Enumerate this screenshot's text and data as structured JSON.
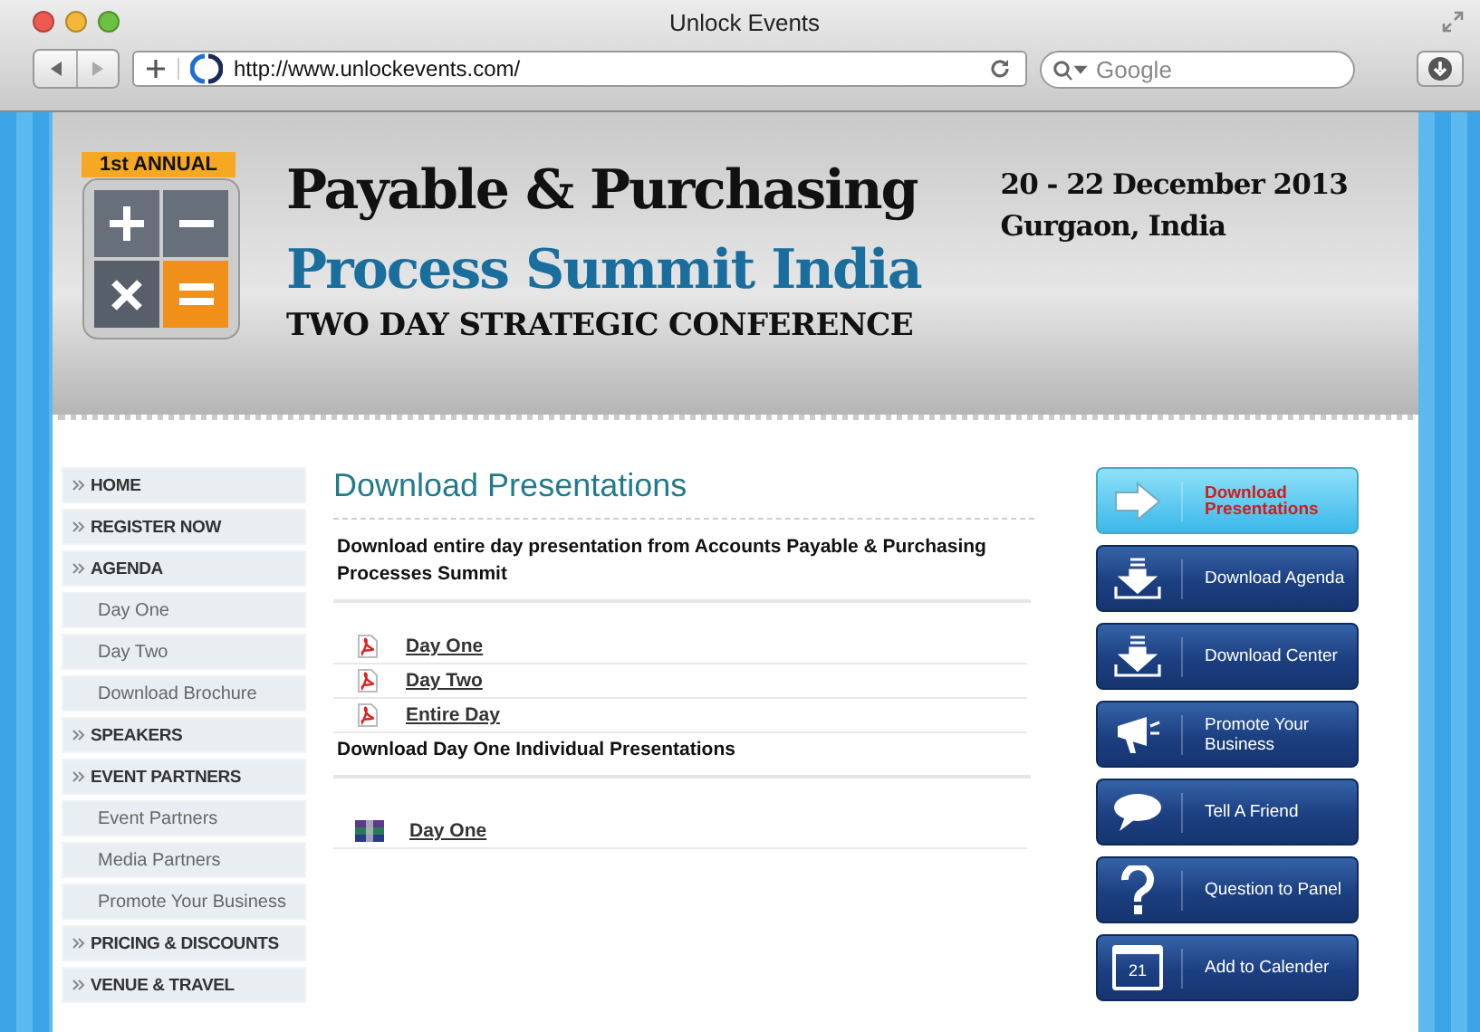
{
  "window": {
    "title": "Unlock Events"
  },
  "toolbar": {
    "url": "http://www.unlockevents.com/",
    "search": {
      "placeholder": "Google"
    }
  },
  "banner": {
    "badge": "1st ANNUAL",
    "title_line_1": "Payable & Purchasing",
    "title_line_2": "Process Summit India",
    "subtitle": "TWO DAY STRATEGIC CONFERENCE",
    "dates": "20 - 22 December 2013",
    "place": "Gurgaon, India"
  },
  "sidebar": {
    "items": [
      {
        "label": "HOME",
        "kind": "section"
      },
      {
        "label": "REGISTER NOW",
        "kind": "section"
      },
      {
        "label": "AGENDA",
        "kind": "section"
      },
      {
        "label": "Day One",
        "kind": "sub"
      },
      {
        "label": "Day Two",
        "kind": "sub"
      },
      {
        "label": "Download Brochure",
        "kind": "sub"
      },
      {
        "label": "SPEAKERS",
        "kind": "section"
      },
      {
        "label": "EVENT PARTNERS",
        "kind": "section"
      },
      {
        "label": "Event Partners",
        "kind": "sub"
      },
      {
        "label": "Media Partners",
        "kind": "sub"
      },
      {
        "label": "Promote Your Business",
        "kind": "sub"
      },
      {
        "label": "PRICING & DISCOUNTS",
        "kind": "section"
      },
      {
        "label": "VENUE & TRAVEL",
        "kind": "section"
      }
    ]
  },
  "main": {
    "heading": "Download Presentations",
    "groups": [
      {
        "title": "Download entire day presentation from Accounts Payable & Purchasing Processes Summit",
        "links": [
          {
            "label": "Day One",
            "kind": "pdf"
          },
          {
            "label": "Day Two",
            "kind": "pdf"
          },
          {
            "label": "Entire Day",
            "kind": "pdf"
          }
        ]
      },
      {
        "title": "Download Day One Individual Presentations",
        "links": [
          {
            "label": "Day One",
            "kind": "archive"
          }
        ]
      }
    ]
  },
  "actions": [
    {
      "label": "Download Presentations",
      "kind": "arrow",
      "selected": true
    },
    {
      "label": "Download Agenda",
      "kind": "download",
      "selected": false
    },
    {
      "label": "Download Center",
      "kind": "download",
      "selected": false
    },
    {
      "label": "Promote Your Business",
      "kind": "megaphone",
      "selected": false
    },
    {
      "label": "Tell A Friend",
      "kind": "speech",
      "selected": false
    },
    {
      "label": "Question to Panel",
      "kind": "question",
      "selected": false
    },
    {
      "label": "Add to Calender",
      "kind": "calendar",
      "icon_label": "21",
      "selected": false
    }
  ]
}
